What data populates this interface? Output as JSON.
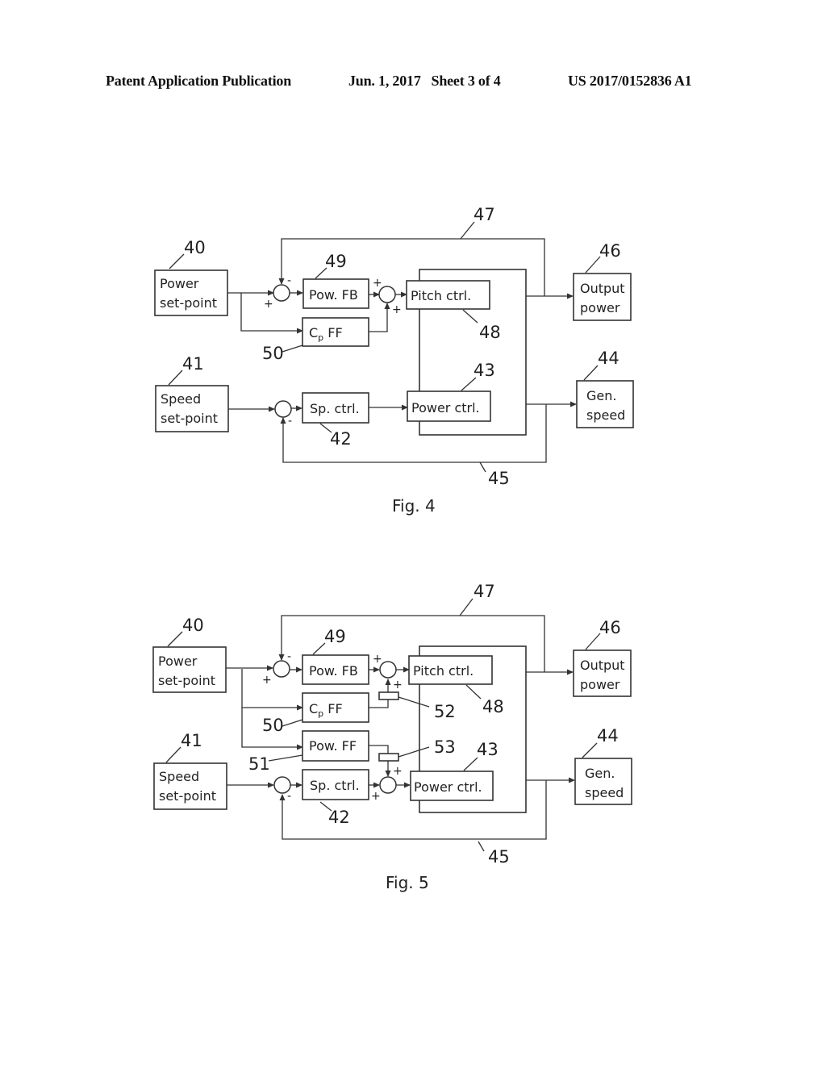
{
  "header": {
    "publication": "Patent Application Publication",
    "date_sheet": "Jun. 1, 2017   Sheet 3 of 4",
    "number": "US 2017/0152836 A1"
  },
  "fig4": {
    "caption": "Fig. 4",
    "blocks": {
      "power_setpoint": [
        "Power",
        "set-point"
      ],
      "speed_setpoint": [
        "Speed",
        "set-point"
      ],
      "pow_fb": "Pow. FB",
      "cp_ff_main": "C",
      "cp_ff_sub": "p",
      "cp_ff_rest": " FF",
      "sp_ctrl": "Sp.  ctrl.",
      "pitch_ctrl": "Pitch ctrl.",
      "power_ctrl": "Power ctrl.",
      "output_power": [
        "Output",
        "power"
      ],
      "gen_speed": [
        "Gen.",
        "speed"
      ]
    },
    "refs": {
      "r40": "40",
      "r41": "41",
      "r42": "42",
      "r43": "43",
      "r44": "44",
      "r45": "45",
      "r46": "46",
      "r47": "47",
      "r48": "48",
      "r49": "49",
      "r50": "50"
    },
    "signs": {
      "minus": "-",
      "plus": "+"
    }
  },
  "fig5": {
    "caption": "Fig. 5",
    "blocks": {
      "power_setpoint": [
        "Power",
        "set-point"
      ],
      "speed_setpoint": [
        "Speed",
        "set-point"
      ],
      "pow_fb": "Pow. FB",
      "cp_ff_main": "C",
      "cp_ff_sub": "p",
      "cp_ff_rest": " FF",
      "pow_ff": "Pow. FF",
      "sp_ctrl": "Sp.  ctrl.",
      "pitch_ctrl": "Pitch ctrl.",
      "power_ctrl": "Power ctrl.",
      "output_power": [
        "Output",
        "power"
      ],
      "gen_speed": [
        "Gen.",
        "speed"
      ]
    },
    "refs": {
      "r40": "40",
      "r41": "41",
      "r42": "42",
      "r43": "43",
      "r44": "44",
      "r45": "45",
      "r46": "46",
      "r47": "47",
      "r48": "48",
      "r49": "49",
      "r50": "50",
      "r51": "51",
      "r52": "52",
      "r53": "53"
    },
    "signs": {
      "minus": "-",
      "plus": "+"
    }
  }
}
